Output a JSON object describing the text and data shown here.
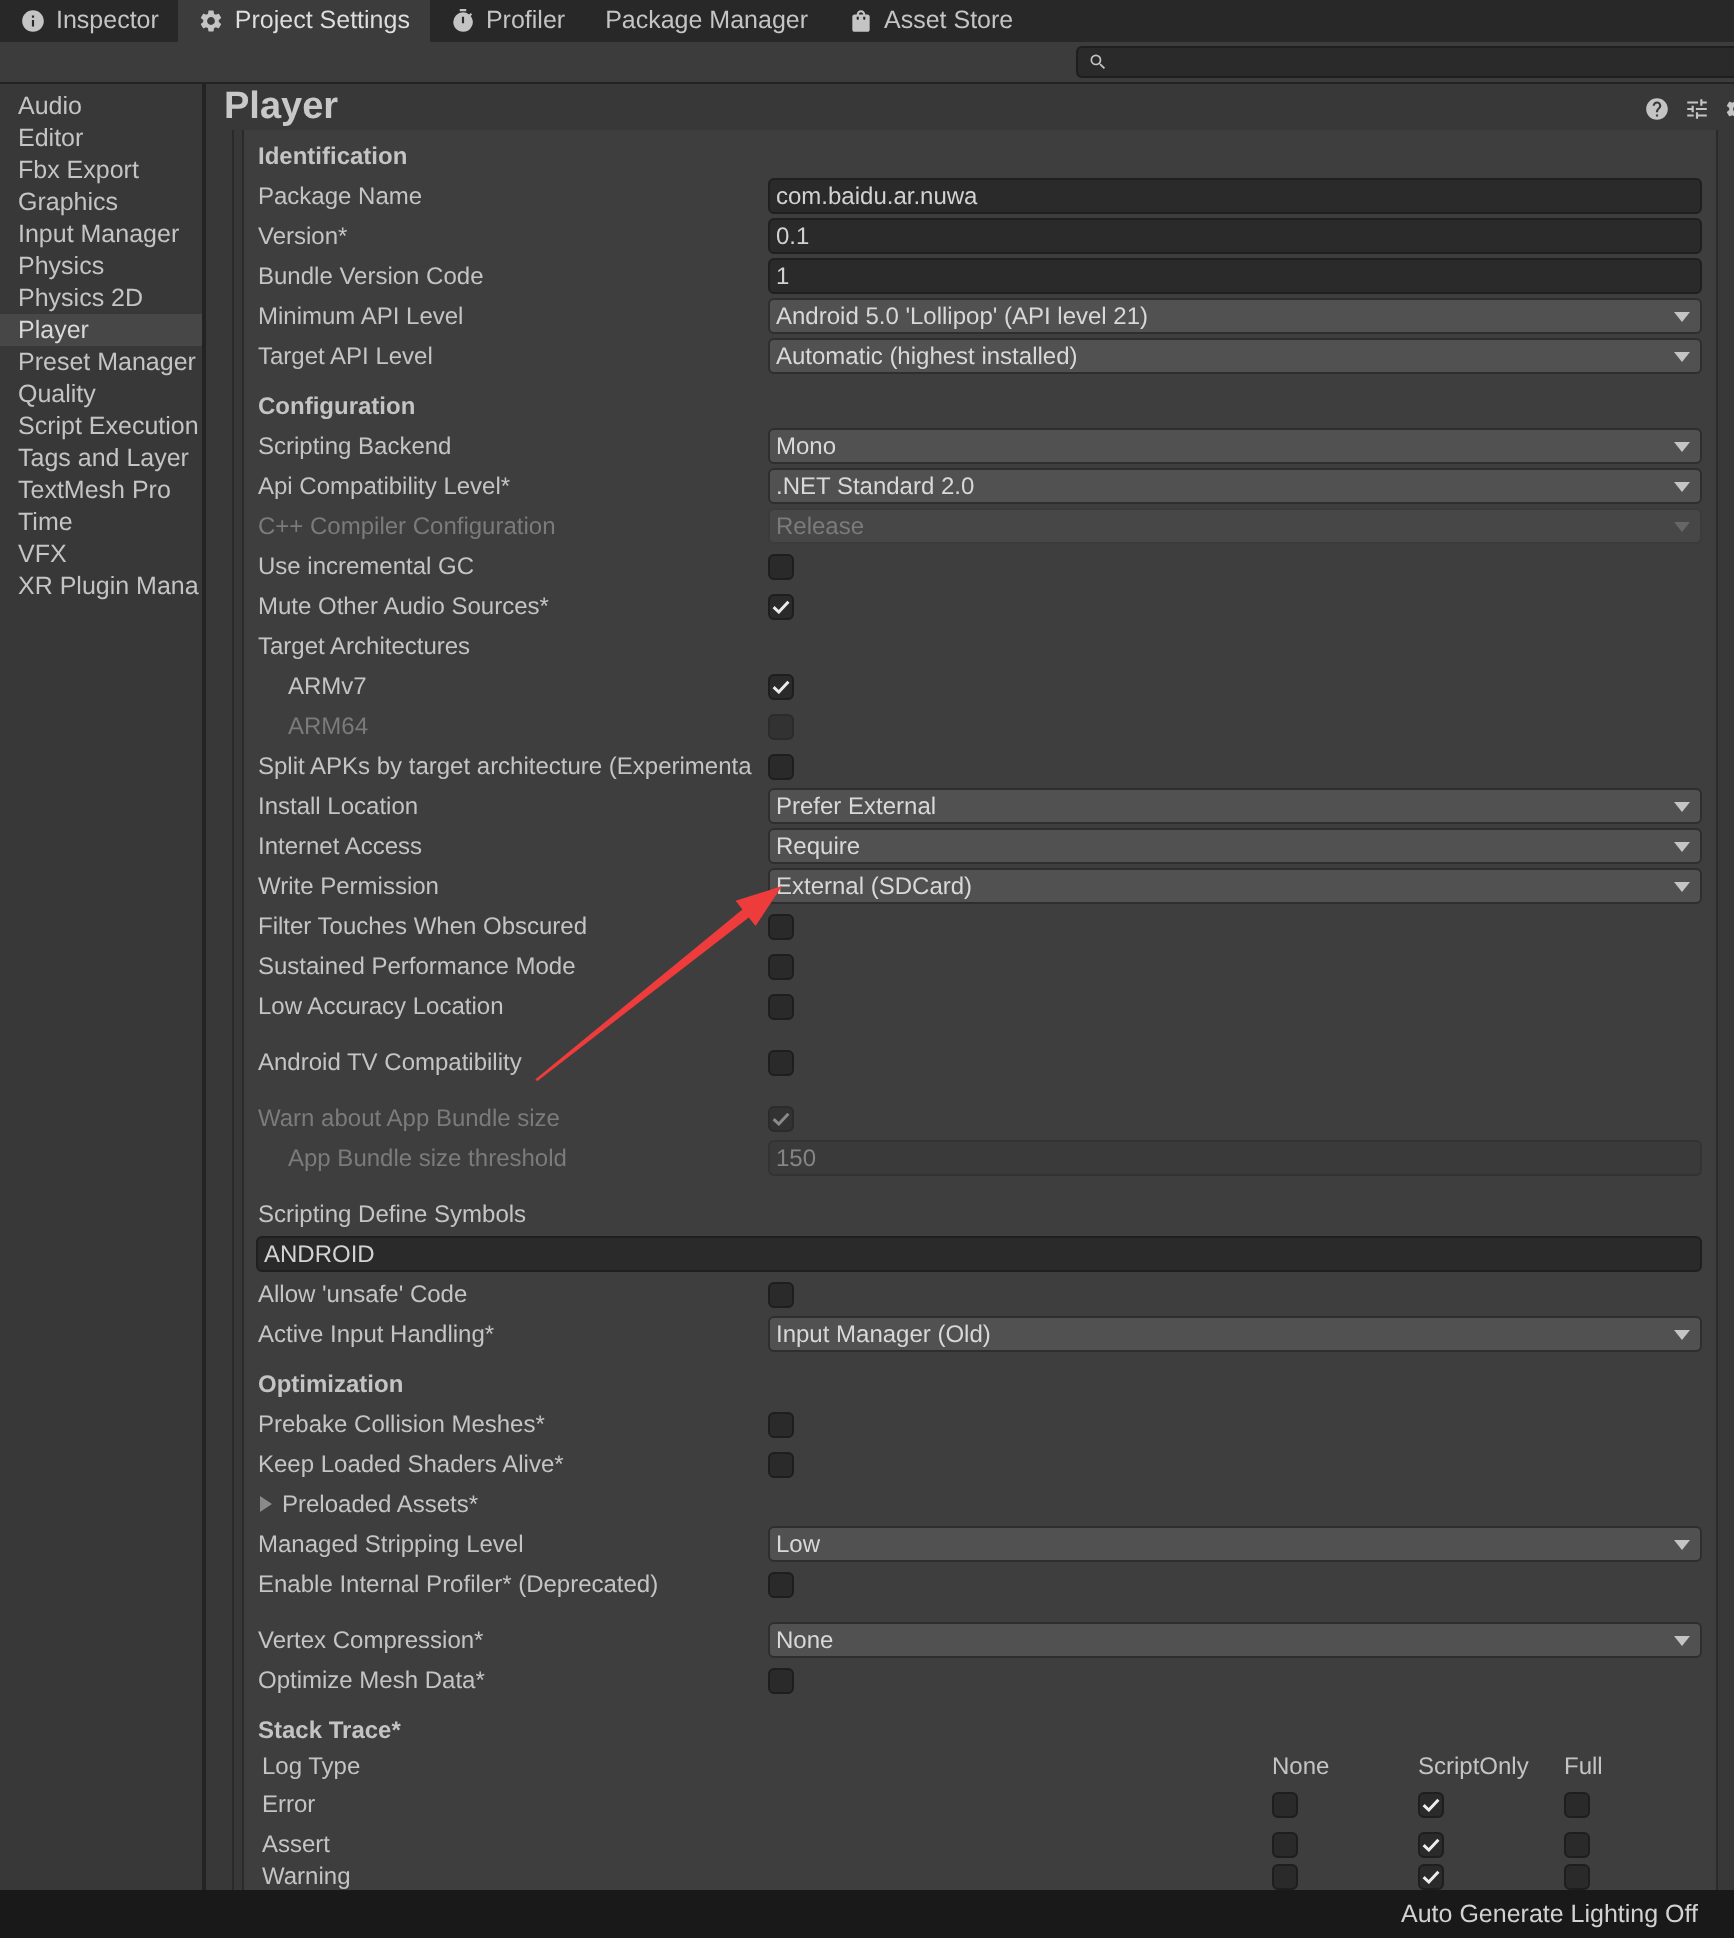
{
  "tabs": [
    {
      "label": "Inspector",
      "selected": false
    },
    {
      "label": "Project Settings",
      "selected": true
    },
    {
      "label": "Profiler",
      "selected": false
    },
    {
      "label": "Package Manager",
      "selected": false
    },
    {
      "label": "Asset Store",
      "selected": false
    }
  ],
  "sidebar": {
    "items": [
      {
        "label": "Audio",
        "selected": false
      },
      {
        "label": "Editor",
        "selected": false
      },
      {
        "label": "Fbx Export",
        "selected": false
      },
      {
        "label": "Graphics",
        "selected": false
      },
      {
        "label": "Input Manager",
        "selected": false
      },
      {
        "label": "Physics",
        "selected": false
      },
      {
        "label": "Physics 2D",
        "selected": false
      },
      {
        "label": "Player",
        "selected": true
      },
      {
        "label": "Preset Manager",
        "selected": false
      },
      {
        "label": "Quality",
        "selected": false
      },
      {
        "label": "Script Execution",
        "selected": false
      },
      {
        "label": "Tags and Layer",
        "selected": false
      },
      {
        "label": "TextMesh Pro",
        "selected": false
      },
      {
        "label": "Time",
        "selected": false
      },
      {
        "label": "VFX",
        "selected": false
      },
      {
        "label": "XR Plugin Mana",
        "selected": false
      }
    ]
  },
  "panel": {
    "title": "Player"
  },
  "sections": [
    {
      "title": "Identification",
      "groups": [
        [
          {
            "kind": "text",
            "label": "Package Name",
            "value": "com.baidu.ar.nuwa",
            "disabled": false
          },
          {
            "kind": "text",
            "label": "Version*",
            "value": "0.1",
            "disabled": false
          },
          {
            "kind": "text",
            "label": "Bundle Version Code",
            "value": "1",
            "disabled": false
          },
          {
            "kind": "dropdown",
            "label": "Minimum API Level",
            "value": "Android 5.0 'Lollipop' (API level 21)",
            "disabled": false
          },
          {
            "kind": "dropdown",
            "label": "Target API Level",
            "value": "Automatic (highest installed)",
            "disabled": false
          }
        ]
      ]
    },
    {
      "title": "Configuration",
      "groups": [
        [
          {
            "kind": "dropdown",
            "label": "Scripting Backend",
            "value": "Mono",
            "disabled": false
          },
          {
            "kind": "dropdown",
            "label": "Api Compatibility Level*",
            "value": ".NET Standard 2.0",
            "disabled": false
          },
          {
            "kind": "dropdown",
            "label": "C++ Compiler Configuration",
            "value": "Release",
            "disabled": true
          },
          {
            "kind": "checkbox",
            "label": "Use incremental GC",
            "checked": false,
            "disabled": false
          },
          {
            "kind": "checkbox",
            "label": "Mute Other Audio Sources*",
            "checked": true,
            "disabled": false
          },
          {
            "kind": "label",
            "label": "Target Architectures",
            "disabled": false,
            "children": [
              {
                "kind": "checkbox",
                "label": "ARMv7",
                "checked": true,
                "disabled": false
              },
              {
                "kind": "checkbox",
                "label": "ARM64",
                "checked": false,
                "disabled": true
              }
            ]
          },
          {
            "kind": "checkbox",
            "label": "Split APKs by target architecture (Experimenta",
            "checked": false,
            "disabled": false
          },
          {
            "kind": "dropdown",
            "label": "Install Location",
            "value": "Prefer External",
            "disabled": false
          },
          {
            "kind": "dropdown",
            "label": "Internet Access",
            "value": "Require",
            "disabled": false
          },
          {
            "kind": "dropdown",
            "label": "Write Permission",
            "value": "External (SDCard)",
            "disabled": false
          },
          {
            "kind": "checkbox",
            "label": "Filter Touches When Obscured",
            "checked": false,
            "disabled": false
          },
          {
            "kind": "checkbox",
            "label": "Sustained Performance Mode",
            "checked": false,
            "disabled": false
          },
          {
            "kind": "checkbox",
            "label": "Low Accuracy Location",
            "checked": false,
            "disabled": false
          }
        ],
        [
          {
            "kind": "checkbox",
            "label": "Android TV Compatibility",
            "checked": false,
            "disabled": false
          }
        ],
        [
          {
            "kind": "checkbox",
            "label": "Warn about App Bundle size",
            "checked": true,
            "disabled": true,
            "children": [
              {
                "kind": "text",
                "label": "App Bundle size threshold",
                "value": "150",
                "disabled": true
              }
            ]
          }
        ],
        [
          {
            "kind": "wide-text",
            "label": "Scripting Define Symbols",
            "value": "ANDROID",
            "disabled": false
          },
          {
            "kind": "checkbox",
            "label": "Allow 'unsafe' Code",
            "checked": false,
            "disabled": false
          },
          {
            "kind": "dropdown",
            "label": "Active Input Handling*",
            "value": "Input Manager (Old)",
            "disabled": false
          }
        ]
      ]
    },
    {
      "title": "Optimization",
      "groups": [
        [
          {
            "kind": "checkbox",
            "label": "Prebake Collision Meshes*",
            "checked": false,
            "disabled": false
          },
          {
            "kind": "checkbox",
            "label": "Keep Loaded Shaders Alive*",
            "checked": false,
            "disabled": false
          },
          {
            "kind": "foldout",
            "label": "Preloaded Assets*",
            "expanded": false,
            "disabled": false
          },
          {
            "kind": "dropdown",
            "label": "Managed Stripping Level",
            "value": "Low",
            "disabled": false
          },
          {
            "kind": "checkbox",
            "label": "Enable Internal Profiler* (Deprecated)",
            "checked": false,
            "disabled": false
          }
        ],
        [
          {
            "kind": "dropdown",
            "label": "Vertex Compression*",
            "value": "None",
            "disabled": false
          },
          {
            "kind": "checkbox",
            "label": "Optimize Mesh Data*",
            "checked": false,
            "disabled": false
          }
        ]
      ]
    },
    {
      "title": "Stack Trace*",
      "table": {
        "columns": [
          "Log Type",
          "None",
          "ScriptOnly",
          "Full"
        ],
        "rows": [
          {
            "label": "Error",
            "cells": [
              {
                "checked": false
              },
              {
                "checked": true
              },
              {
                "checked": false
              }
            ]
          },
          {
            "label": "Assert",
            "cells": [
              {
                "checked": false
              },
              {
                "checked": true
              },
              {
                "checked": false
              }
            ]
          },
          {
            "label": "Warning",
            "cells": [
              {
                "checked": false
              },
              {
                "checked": true
              },
              {
                "checked": false
              }
            ]
          }
        ]
      }
    }
  ],
  "status_bar": {
    "text": "Auto Generate Lighting Off"
  }
}
